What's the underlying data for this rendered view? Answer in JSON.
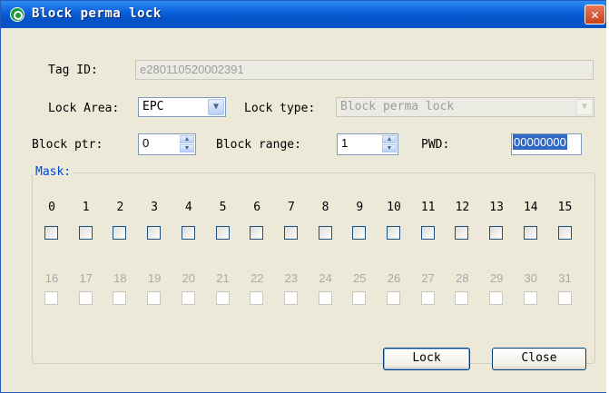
{
  "window": {
    "title": "Block perma lock",
    "close_glyph": "✕"
  },
  "tag_id": {
    "label": "Tag ID:",
    "value": "e280110520002391"
  },
  "lock_area": {
    "label": "Lock Area:",
    "value": "EPC"
  },
  "lock_type": {
    "label": "Lock type:",
    "value": "Block perma lock"
  },
  "block_ptr": {
    "label": "Block ptr:",
    "value": "0"
  },
  "block_range": {
    "label": "Block range:",
    "value": "1"
  },
  "pwd": {
    "label": "PWD:",
    "value": "00000000"
  },
  "mask": {
    "label": "Mask:",
    "row1": [
      "0",
      "1",
      "2",
      "3",
      "4",
      "5",
      "6",
      "7",
      "8",
      "9",
      "10",
      "11",
      "12",
      "13",
      "14",
      "15"
    ],
    "row2": [
      "16",
      "17",
      "18",
      "19",
      "20",
      "21",
      "22",
      "23",
      "24",
      "25",
      "26",
      "27",
      "28",
      "29",
      "30",
      "31"
    ]
  },
  "buttons": {
    "lock": "Lock",
    "close": "Close"
  },
  "colors": {
    "title_bar": "#0a5fd8",
    "group_legend": "#0046d5",
    "disabled_text": "#a9a9a9"
  }
}
